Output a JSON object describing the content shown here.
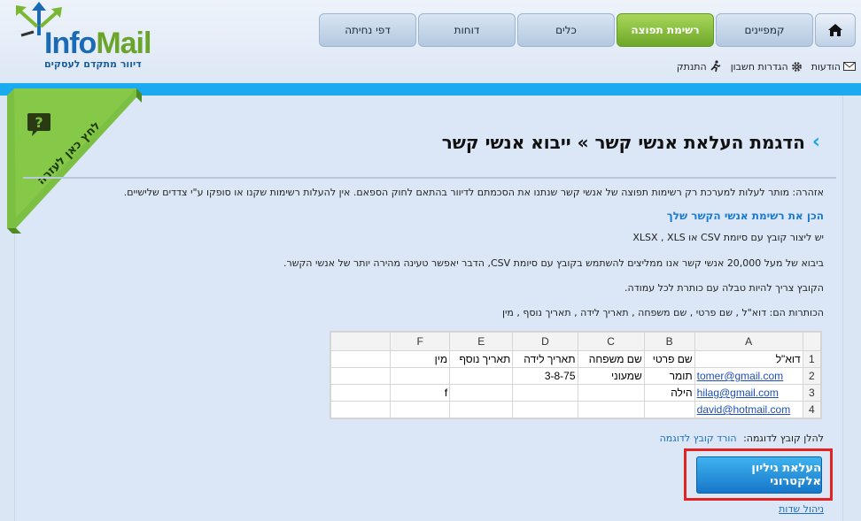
{
  "brand": {
    "name_prefix": "Info",
    "name_suffix": "Mail",
    "tagline": "דיוור מתקדם לעסקים",
    "colors": {
      "primary": "#1a6bb3",
      "green": "#7ab833",
      "accent_blue": "#19aaf0"
    }
  },
  "nav": {
    "home_icon": "home-icon",
    "tabs": [
      {
        "label": "קמפיינים",
        "active": false
      },
      {
        "label": "רשימת תפוצה",
        "active": true
      },
      {
        "label": "כלים",
        "active": false
      },
      {
        "label": "דוחות",
        "active": false
      },
      {
        "label": "דפי נחיתה",
        "active": false
      }
    ]
  },
  "utility": {
    "messages": "הודעות",
    "settings": "הגדרות חשבון",
    "logout": "התנתק"
  },
  "help": {
    "label": "לחץ כאן לעזרה",
    "icon": "question-icon"
  },
  "page": {
    "title": "הדגמת העלאת אנשי קשר » ייבוא אנשי קשר",
    "warning": "אזהרה: מותר לעלות למערכת רק רשימות תפוצה של אנשי קשר שנתנו את הסכמתם לדיוור בהתאם לחוק הספאם. אין להעלות רשימות שקנו או סופקו ע\"י צדדים שלישיים.",
    "section_heading": "הכן את רשימת אנשי הקשר שלך",
    "lines": [
      "יש ליצור קובץ עם סיומת CSV או XLSX , XLS",
      "ביבוא של מעל 20,000 אנשי קשר אנו ממליצים להשתמש בקובץ עם סיומת CSV, הדבר יאפשר טעינה מהירה יותר של אנשי הקשר.",
      "הקובץ צריך להיות טבלה עם כותרת לכל עמודה.",
      "הכותרות הם: דוא\"ל , שם פרטי , שם משפחה , תאריך לידה , תאריך נוסף , מין"
    ],
    "download_label": "להלן קובץ לדוגמה:",
    "download_link": "הורד קובץ לדוגמה",
    "upload_button": "העלאת גיליון אלקטרוני",
    "fields_link": "ניהול שדות"
  },
  "sheet": {
    "columns": [
      "A",
      "B",
      "C",
      "D",
      "E",
      "F"
    ],
    "rows": [
      {
        "num": "1",
        "cells": [
          "דוא\"ל",
          "שם פרטי",
          "שם משפחה",
          "תאריך לידה",
          "תאריך נוסף",
          "מין"
        ]
      },
      {
        "num": "2",
        "cells": [
          "tomer@gmail.com",
          "תומר",
          "שמעוני",
          "3-8-75",
          "",
          ""
        ]
      },
      {
        "num": "3",
        "cells": [
          "hilag@gmail.com",
          "הילה",
          "",
          "",
          "",
          "f"
        ]
      },
      {
        "num": "4",
        "cells": [
          "david@hotmail.com",
          "",
          "",
          "",
          "",
          ""
        ]
      }
    ]
  }
}
